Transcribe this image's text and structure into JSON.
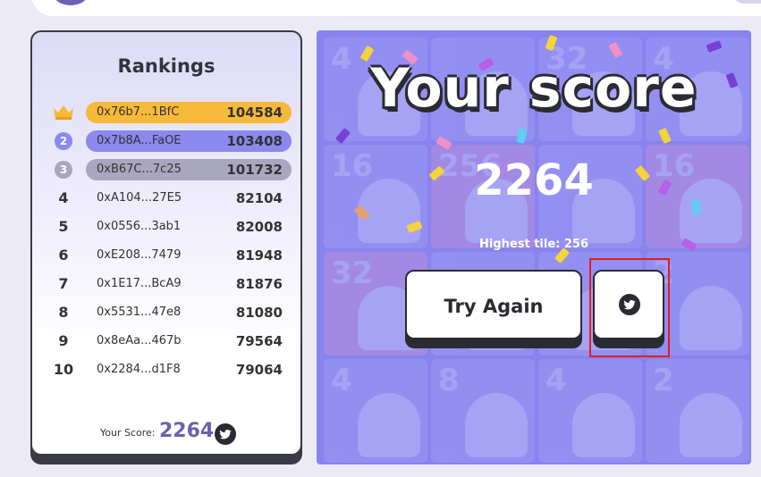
{
  "rankings": {
    "title": "Rankings",
    "rows": [
      {
        "rank": "1",
        "address": "0x76b7...1BfC",
        "score": "104584"
      },
      {
        "rank": "2",
        "address": "0x7b8A...FaOE",
        "score": "103408"
      },
      {
        "rank": "3",
        "address": "0xB67C...7c25",
        "score": "101732"
      },
      {
        "rank": "4",
        "address": "0xA104...27E5",
        "score": "82104"
      },
      {
        "rank": "5",
        "address": "0x0556...3ab1",
        "score": "82008"
      },
      {
        "rank": "6",
        "address": "0xE208...7479",
        "score": "81948"
      },
      {
        "rank": "7",
        "address": "0x1E17...BcA9",
        "score": "81876"
      },
      {
        "rank": "8",
        "address": "0x5531...47e8",
        "score": "81080"
      },
      {
        "rank": "9",
        "address": "0x8eAa...467b",
        "score": "79564"
      },
      {
        "rank": "10",
        "address": "0x2284...d1F8",
        "score": "79064"
      }
    ],
    "your_score_label": "Your Score:",
    "your_score_value": "2264"
  },
  "result": {
    "title": "Your score",
    "score": "2264",
    "highest_tile": "Highest tile: 256",
    "try_again_label": "Try Again"
  },
  "background_tiles": [
    "4",
    "32",
    "4",
    "16",
    "256",
    "16",
    "32",
    "2",
    "4",
    "8",
    "4",
    "2"
  ],
  "icons": {
    "crown": "crown-icon",
    "twitter": "twitter-icon"
  },
  "colors": {
    "gold": "#f7b93a",
    "silver_blue": "#8b88ee",
    "bronze_gray": "#a9a7c0",
    "panel": "#8883ee",
    "highlight": "#e01d1d"
  }
}
